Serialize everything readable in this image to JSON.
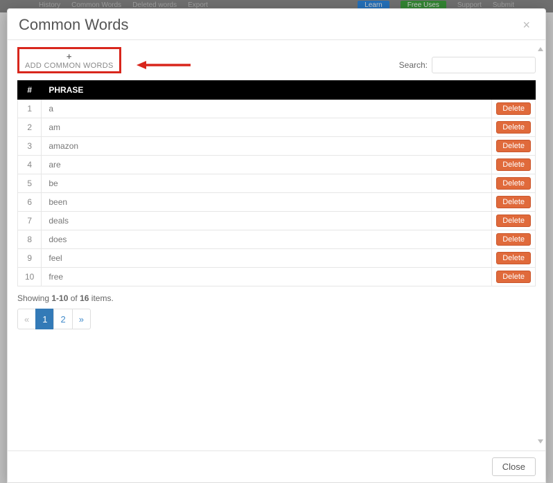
{
  "bg_nav": {
    "items": [
      "History",
      "Common Words",
      "Deleted words",
      "Export"
    ],
    "learn": "Learn",
    "free": "Free Uses",
    "support": "Support",
    "submit": "Submit"
  },
  "modal": {
    "title": "Common Words",
    "add_label": "ADD COMMON WORDS",
    "plus": "+",
    "search_label": "Search:",
    "search_placeholder": "",
    "close_x": "×",
    "footer_close": "Close"
  },
  "table": {
    "headers": {
      "num": "#",
      "phrase": "PHRASE",
      "actions": ""
    },
    "delete_label": "Delete",
    "rows": [
      {
        "n": "1",
        "phrase": "a"
      },
      {
        "n": "2",
        "phrase": "am"
      },
      {
        "n": "3",
        "phrase": "amazon"
      },
      {
        "n": "4",
        "phrase": "are"
      },
      {
        "n": "5",
        "phrase": "be"
      },
      {
        "n": "6",
        "phrase": "been"
      },
      {
        "n": "7",
        "phrase": "deals"
      },
      {
        "n": "8",
        "phrase": "does"
      },
      {
        "n": "9",
        "phrase": "feel"
      },
      {
        "n": "10",
        "phrase": "free"
      }
    ]
  },
  "summary": {
    "prefix": "Showing ",
    "range": "1-10",
    "mid": " of ",
    "total": "16",
    "suffix": " items."
  },
  "pagination": {
    "prev": "«",
    "pages": [
      "1",
      "2"
    ],
    "active_index": 0,
    "next": "»"
  },
  "colors": {
    "highlight_border": "#d8261c",
    "arrow": "#d8261c",
    "primary": "#337ab7",
    "delete": "#e06a3b"
  }
}
